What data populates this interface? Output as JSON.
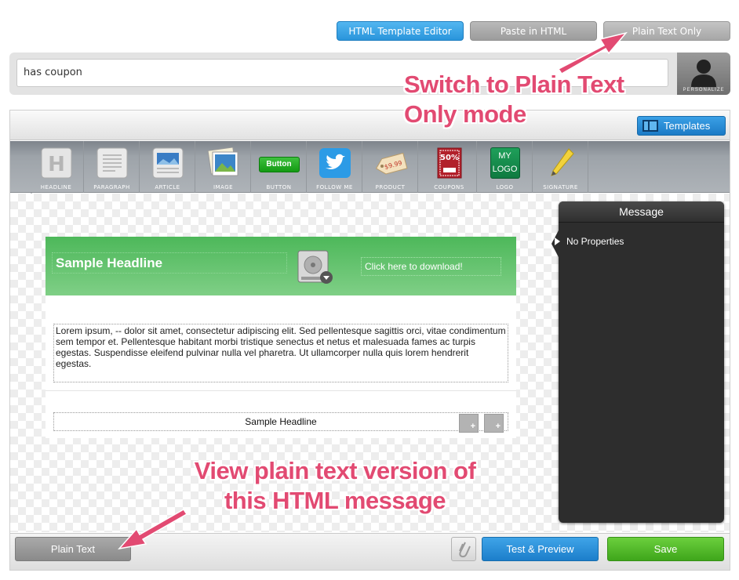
{
  "mode_tabs": {
    "html_editor": "HTML Template Editor",
    "paste_html": "Paste in HTML",
    "plain_text_only": "Plain Text Only"
  },
  "subject": {
    "value": "has coupon"
  },
  "personalize": {
    "label": "PERSONALIZE"
  },
  "templates_button": "Templates",
  "toolbar": {
    "items": [
      {
        "label": "HEADLINE",
        "icon": "headline-icon"
      },
      {
        "label": "PARAGRAPH",
        "icon": "paragraph-icon"
      },
      {
        "label": "ARTICLE",
        "icon": "article-icon"
      },
      {
        "label": "IMAGE",
        "icon": "image-icon"
      },
      {
        "label": "BUTTON",
        "icon": "button-icon",
        "icon_text": "Button"
      },
      {
        "label": "FOLLOW ME",
        "icon": "twitter-icon"
      },
      {
        "label": "PRODUCT",
        "icon": "price-tag-icon",
        "icon_text": "$9.99"
      },
      {
        "label": "COUPONS",
        "icon": "coupon-icon",
        "icon_text": "50%"
      },
      {
        "label": "LOGO",
        "icon": "logo-icon",
        "icon_text": "MY LOGO"
      },
      {
        "label": "SIGNATURE",
        "icon": "pen-icon"
      }
    ]
  },
  "message": {
    "headline": "Sample Headline",
    "download_link": "Click here to download!",
    "body": "Lorem ipsum,   -- dolor sit amet, consectetur adipiscing elit. Sed pellentesque sagittis orci, vitae condimentum sem tempor et. Pellentesque habitant morbi tristique senectus et netus et malesuada fames ac turpis egestas. Suspendisse eleifend pulvinar nulla vel pharetra. Ut ullamcorper nulla quis lorem hendrerit egestas.",
    "headline2": "Sample Headline"
  },
  "properties_panel": {
    "title": "Message",
    "empty_text": "No Properties"
  },
  "footer": {
    "plain_text": "Plain Text",
    "test_preview": "Test & Preview",
    "save": "Save"
  },
  "annotations": {
    "switch_plain": "Switch to Plain Text Only mode",
    "view_plain": "View plain text version of this HTML message"
  },
  "colors": {
    "accent_blue": "#2a95db",
    "save_green": "#3fa61b",
    "banner_green": "#4db85a",
    "annotation_pink": "#e24a72"
  }
}
